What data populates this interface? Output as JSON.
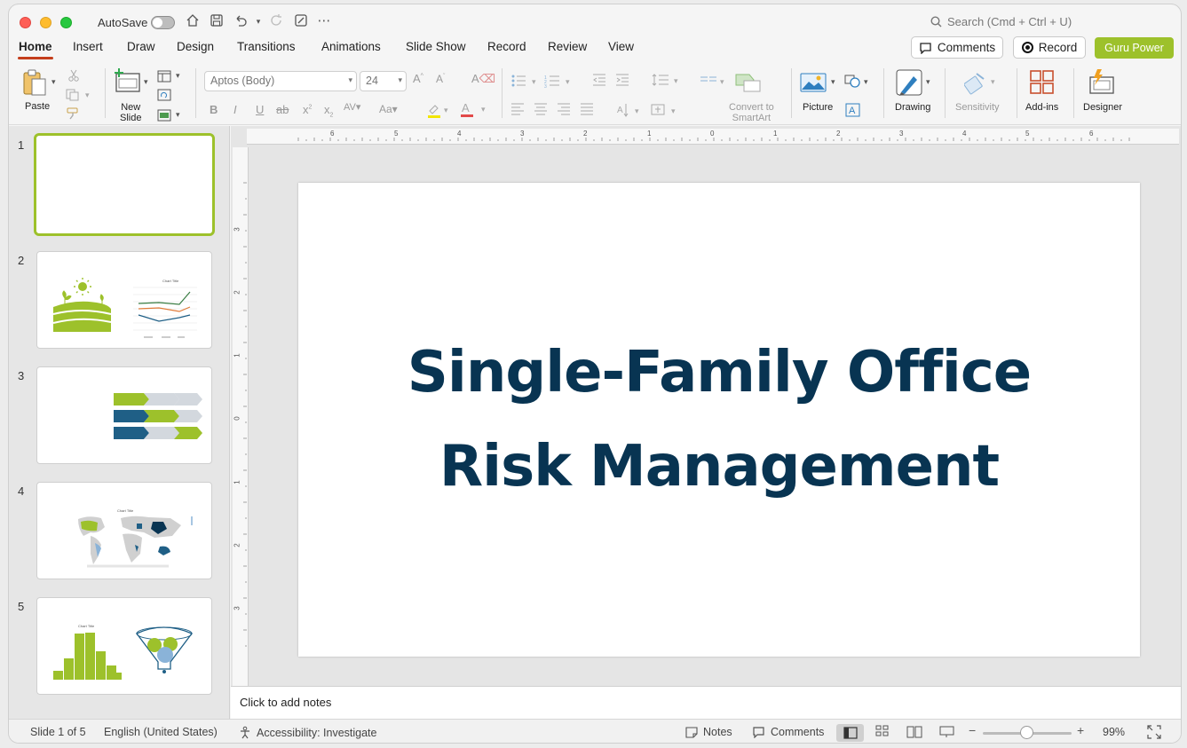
{
  "titlebar": {
    "autosave_label": "AutoSave",
    "search_placeholder": "Search (Cmd + Ctrl + U)"
  },
  "tabs": [
    "Home",
    "Insert",
    "Draw",
    "Design",
    "Transitions",
    "Animations",
    "Slide Show",
    "Record",
    "Review",
    "View"
  ],
  "active_tab": "Home",
  "header_buttons": {
    "comments": "Comments",
    "record": "Record",
    "guru": "Guru Power"
  },
  "ribbon": {
    "paste": "Paste",
    "new_slide_line1": "New",
    "new_slide_line2": "Slide",
    "font_name": "Aptos (Body)",
    "font_size": "24",
    "convert_line1": "Convert to",
    "convert_line2": "SmartArt",
    "picture": "Picture",
    "drawing": "Drawing",
    "sensitivity": "Sensitivity",
    "addins": "Add-ins",
    "designer": "Designer"
  },
  "thumbnails": {
    "numbers": [
      "1",
      "2",
      "3",
      "4",
      "5"
    ],
    "chart_title": "Chart Title"
  },
  "slide": {
    "title_line1": "Single-Family Office",
    "title_line2": "Risk Management"
  },
  "rulers": {
    "horizontal": [
      "6",
      "5",
      "4",
      "3",
      "2",
      "1",
      "0",
      "1",
      "2",
      "3",
      "4",
      "5",
      "6"
    ],
    "vertical": [
      "3",
      "2",
      "1",
      "0",
      "1",
      "2",
      "3"
    ]
  },
  "notes_placeholder": "Click to add notes",
  "statusbar": {
    "slide_info": "Slide 1 of 5",
    "language": "English (United States)",
    "accessibility": "Accessibility: Investigate",
    "notes": "Notes",
    "comments": "Comments",
    "zoom": "99%"
  },
  "colors": {
    "accent_green": "#9dc12b",
    "title_navy": "#083452",
    "tab_underline": "#c43e1c"
  }
}
